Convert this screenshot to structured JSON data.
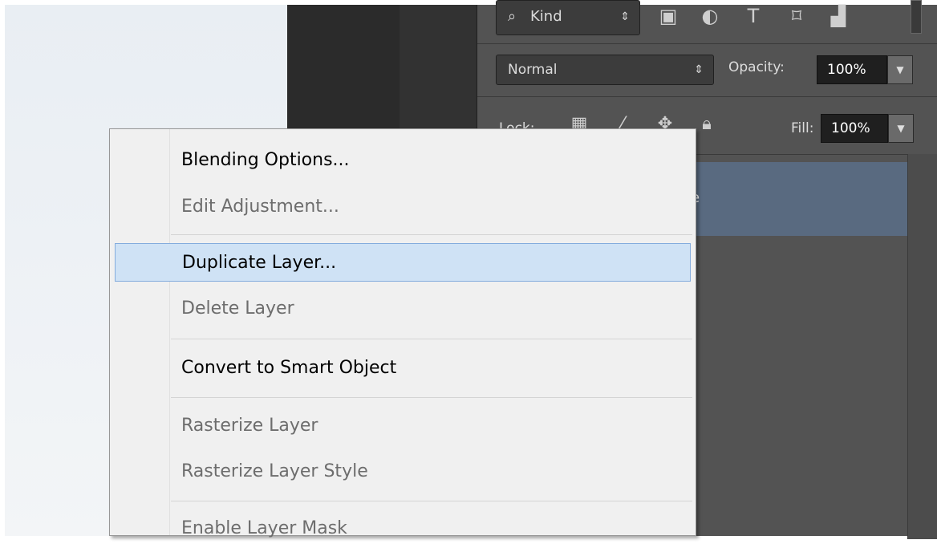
{
  "layers_panel": {
    "filter": {
      "label": "Kind",
      "icon": "search-icon"
    },
    "blend_mode": "Normal",
    "opacity": {
      "label": "Opacity:",
      "value": "100%"
    },
    "lock": {
      "label": "Lock:"
    },
    "fill": {
      "label": "Fill:",
      "value": "100%"
    },
    "selected_layer_name_visible": "e"
  },
  "context_menu": {
    "items": [
      {
        "label": "Blending Options...",
        "enabled": true
      },
      {
        "label": "Edit Adjustment...",
        "enabled": false
      },
      {
        "label": "Duplicate Layer...",
        "enabled": true,
        "highlighted": true
      },
      {
        "label": "Delete Layer",
        "enabled": false
      },
      {
        "label": "Convert to Smart Object",
        "enabled": true
      },
      {
        "label": "Rasterize Layer",
        "enabled": false
      },
      {
        "label": "Rasterize Layer Style",
        "enabled": false
      },
      {
        "label": "Enable Layer Mask",
        "enabled": false
      }
    ]
  },
  "colors": {
    "panel_bg": "#535353",
    "selected_layer": "#596a80",
    "menu_bg": "#f0f0f0",
    "menu_highlight": "#cfe2f5"
  }
}
